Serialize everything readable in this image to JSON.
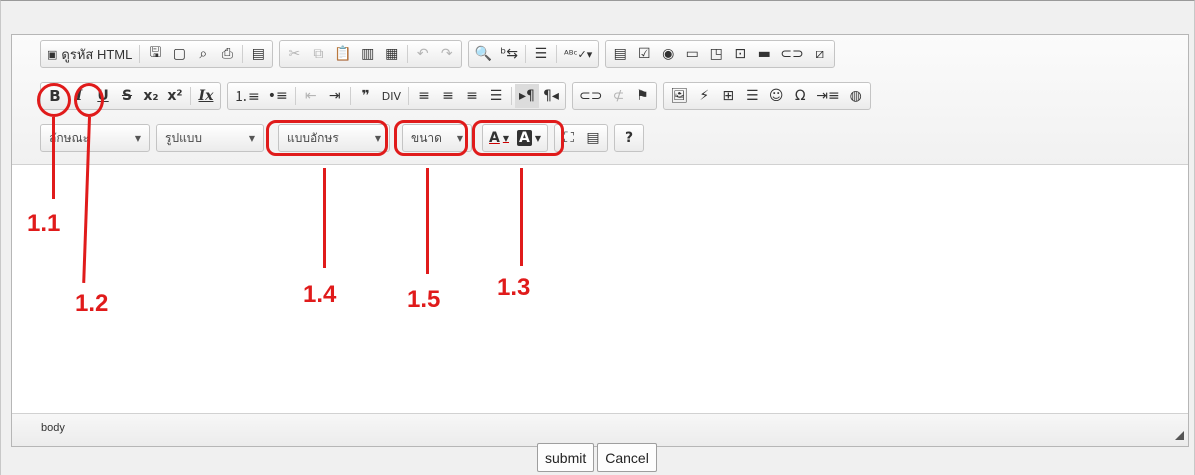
{
  "toolbar": {
    "row1": {
      "source_label": "ดูรหัส HTML",
      "icons": [
        "save-icon",
        "new-page-icon",
        "preview-icon",
        "print-icon",
        "templates-icon",
        "cut-icon",
        "copy-icon",
        "paste-icon",
        "paste-text-icon",
        "paste-word-icon",
        "undo-icon",
        "redo-icon",
        "find-icon",
        "replace-icon",
        "select-all-icon",
        "spellcheck-icon",
        "form-icon",
        "checkbox-icon",
        "radio-icon",
        "textfield-icon",
        "textarea-icon",
        "select-icon",
        "button-icon",
        "imagebutton-icon",
        "hiddenfield-icon"
      ]
    },
    "row2": {
      "bold": "B",
      "italic": "I",
      "underline": "U",
      "strike": "S",
      "subscript": "x₂",
      "superscript": "x²",
      "remove_format": "Ix"
    },
    "row3": {
      "styles": "ลักษณะ",
      "format": "รูปแบบ",
      "font": "แบบอักษร",
      "size": "ขนาด",
      "text_color": "A",
      "bg_color": "A",
      "help": "?"
    }
  },
  "statusbar": {
    "path": "body"
  },
  "actions": {
    "submit": "submit",
    "cancel": "Cancel"
  },
  "annotations": {
    "bold": "1.1",
    "italic": "1.2",
    "color": "1.3",
    "font": "1.4",
    "size": "1.5",
    "color_hex": "#e01b1b"
  }
}
